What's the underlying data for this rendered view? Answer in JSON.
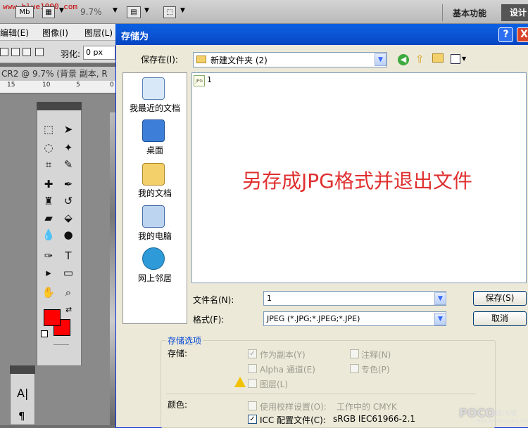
{
  "ps": {
    "watermark": "www.blue1000.com",
    "zoom": "9.7%",
    "mb_label": "Mb",
    "workspace": "基本功能",
    "design": "设计",
    "menu": [
      "编辑(E)",
      "图像(I)",
      "图层(L)"
    ],
    "feather_label": "羽化:",
    "feather_value": "0 px",
    "doc_title": "CR2 @ 9.7% (背景 副本, R",
    "ruler": [
      "15",
      "10",
      "5",
      "0"
    ]
  },
  "dialog": {
    "title": "存储为",
    "help": "?",
    "close": "X",
    "save_in_label": "保存在(I):",
    "folder": "新建文件夹 (2)",
    "places": [
      "我最近的文档",
      "桌面",
      "我的文档",
      "我的电脑",
      "网上邻居"
    ],
    "file_icon_text": "JPG",
    "file": "1",
    "overlay": "另存成JPG格式并退出文件",
    "filename_label": "文件名(N):",
    "filename": "1",
    "format_label": "格式(F):",
    "format": "JPEG (*.JPG;*.JPEG;*.JPE)",
    "save_btn": "保存(S)",
    "cancel_btn": "取消"
  },
  "options": {
    "title": "存储选项",
    "save_label": "存储:",
    "as_copy": "作为副本(Y)",
    "alpha": "Alpha 通道(E)",
    "layers": "图层(L)",
    "notes": "注释(N)",
    "spot": "专色(P)",
    "color_label": "颜色:",
    "proof": "使用校样设置(O):",
    "proof_value": "工作中的 CMYK",
    "icc": "ICC 配置文件(C):",
    "icc_value": "sRGB IEC61966-2.1"
  },
  "brand": {
    "poco": "POCO",
    "poco_sub": "摄影专题",
    "poco_url": "http://photo.poco.cn/"
  }
}
